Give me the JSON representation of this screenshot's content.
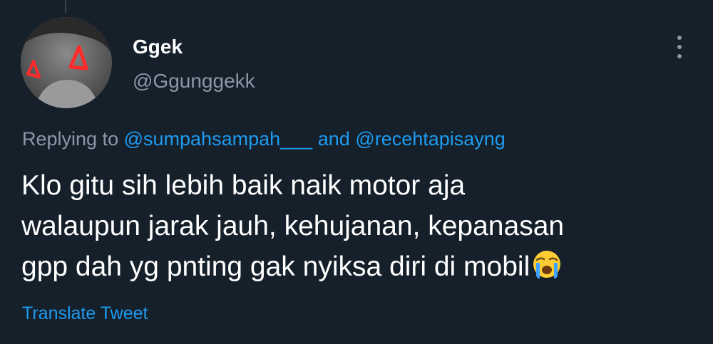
{
  "tweet": {
    "display_name": "Ggek",
    "handle": "@Ggunggekk",
    "replying_prefix": "Replying to",
    "reply_to": [
      "@sumpahsampah___",
      "@recehtapisayng"
    ],
    "reply_joiner": "and",
    "text_lines": [
      "Klo gitu sih lebih baik naik motor aja",
      "walaupun jarak jauh, kehujanan, kepanasan",
      "gpp dah yg pnting gak nyiksa diri di mobil"
    ],
    "emoji": "loudly-crying-face",
    "translate_label": "Translate Tweet"
  },
  "colors": {
    "background": "#15202b",
    "text": "#ffffff",
    "muted": "#8b98a5",
    "accent": "#1d9bf0"
  },
  "icons": {
    "more": "more-vertical-icon"
  }
}
